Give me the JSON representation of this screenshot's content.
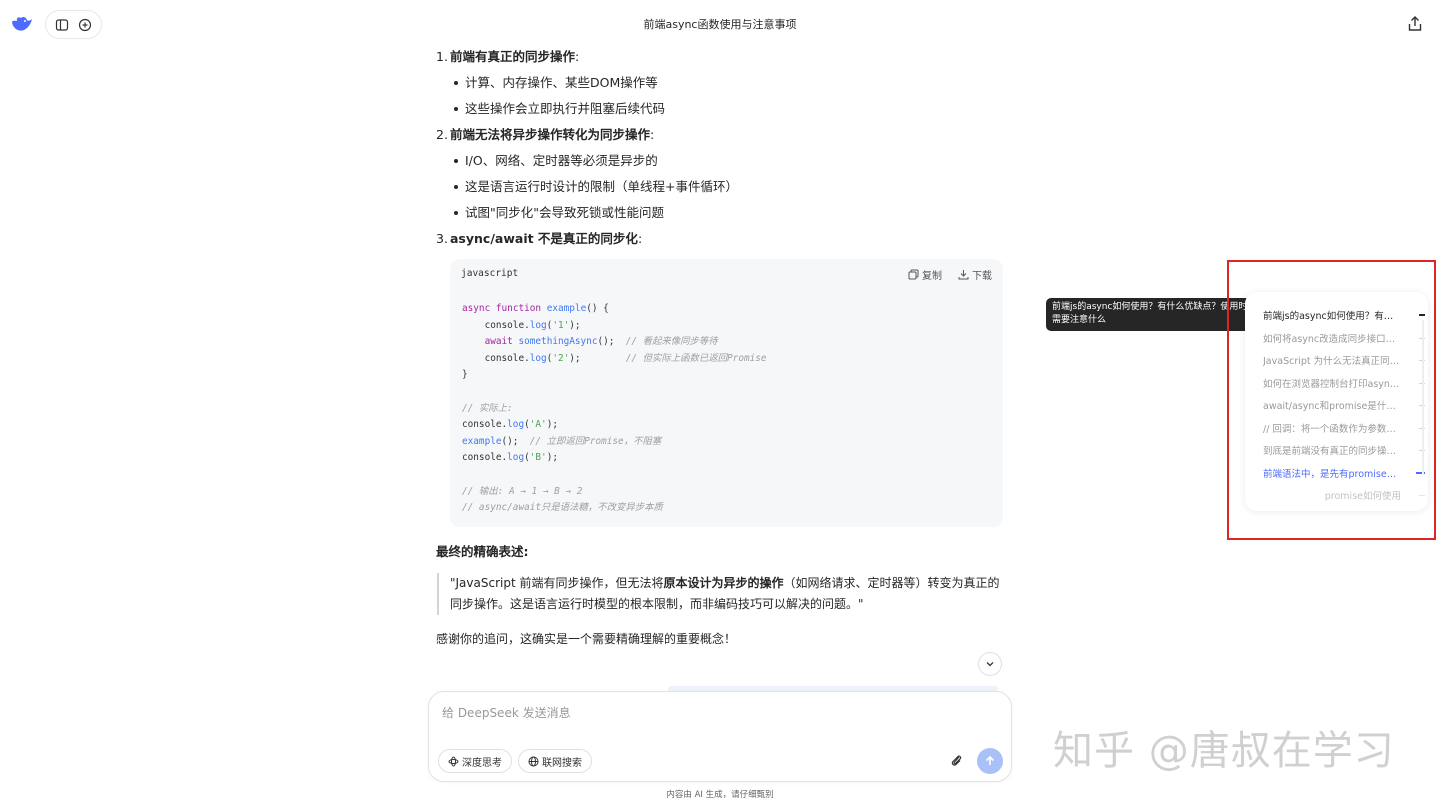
{
  "header": {
    "title": "前端async函数使用与注意事项"
  },
  "content": {
    "sections": [
      {
        "num": "1.",
        "title": "前端有真正的同步操作",
        "colon": ":",
        "bullets": [
          "计算、内存操作、某些DOM操作等",
          "这些操作会立即执行并阻塞后续代码"
        ]
      },
      {
        "num": "2.",
        "title": "前端无法将异步操作转化为同步操作",
        "colon": ":",
        "bullets": [
          "I/O、网络、定时器等必须是异步的",
          "这是语言运行时设计的限制（单线程+事件循环）",
          "试图\"同步化\"会导致死锁或性能问题"
        ]
      },
      {
        "num": "3.",
        "title": "async/await 不是真正的同步化",
        "colon": ":",
        "bullets": []
      }
    ],
    "code": {
      "lang": "javascript",
      "copy": "复制",
      "download": "下载"
    },
    "final_title": "最终的精确表述:",
    "quote": {
      "p1": "\"JavaScript 前端有同步操作，但无法将",
      "bold": "原本设计为异步的操作",
      "p2": "（如网络请求、定时器等）转变为真正的同步操作。这是语言运行时模型的根本限制，而非编码技巧可以解决的问题。\""
    },
    "thanks": "感谢你的追问，这确实是一个需要精确理解的重要概念！"
  },
  "composer": {
    "placeholder": "给 DeepSeek 发送消息",
    "deep_think": "深度思考",
    "web_search": "联网搜索",
    "footnote": "内容由 AI 生成，请仔细甄别"
  },
  "tooltip": "前端js的async如何使用？有什么优缺点？使用时需要注意什么",
  "outline": {
    "items": [
      "前端js的async如何使用？有什么优缺点？使用时需要注意什么",
      "如何将async改造成同步接口使用",
      "JavaScript 为什么无法真正同步化",
      "如何在浏览器控制台打印async的结果",
      "await/async和promise是什么关系",
      "// 回调：将一个函数作为参数传递",
      "到底是前端没有真正的同步操作吗",
      "前端语法中，是先有promise还是async",
      "promise如何使用"
    ],
    "active_index": 7
  },
  "watermark": "知乎 @唐叔在学习",
  "colors": {
    "accent": "#4d6bfe",
    "highlight_box": "#e02424"
  }
}
